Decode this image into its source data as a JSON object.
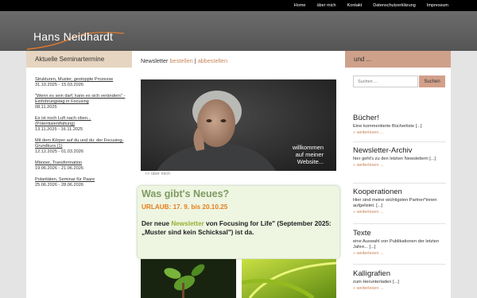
{
  "topnav": [
    "Home",
    "über mich",
    "Kontakt",
    "Datenschutzerklärung",
    "Impressum"
  ],
  "logo": {
    "text": "Hans Neidhardt"
  },
  "left": {
    "title": "Aktuelle Seminartermine",
    "seminars": [
      {
        "title": "Strukturen, Muster, gestoppte Prozesse",
        "date": "31.10.2025 - 15.03.2026"
      },
      {
        "title": "\"Wenn es sein darf, kann es sich verändern\" - Einführungstag in Focusing",
        "date": "08.11.2025"
      },
      {
        "title": "Es ist noch Luft nach oben... (Potentialentfaltung)",
        "date": "13.11.2025 - 16.11.2025"
      },
      {
        "title": "Mit dem Körper auf du und du: der Focusing-Grundkurs (1)",
        "date": "12.12.2025 - 01.03.2026"
      },
      {
        "title": "Männer, Transformation",
        "date": "19.06.2026 - 21.06.2026"
      },
      {
        "title": "Polaritäten, Seminar für Paare",
        "date": "25.06.2026 - 28.06.2026"
      }
    ]
  },
  "center": {
    "newsletter_label": "Newsletter",
    "newsletter_subscribe": "bestellen",
    "newsletter_sep": "|",
    "newsletter_unsubscribe": "abbestellen",
    "hero_caption": [
      "willkommen",
      "auf meiner",
      "Website..."
    ],
    "about_link": ">> über mich",
    "news": {
      "heading": "Was gibt's Neues?",
      "urlaub": "URLAUB: 17. 9. bis 20.10.25",
      "body_pre": "Der neue ",
      "body_link": "Newsletter",
      "body_post": " von Focusing for Life\" (September 2025: „Muster sind kein Schicksal\") ist da."
    }
  },
  "right": {
    "title": "und ...",
    "search": {
      "placeholder": "Suchen ...",
      "button": "Suchen"
    },
    "widgets": [
      {
        "title": "Bücher!",
        "text": "Eine kommentierte Bücherliste [...]",
        "more": "» weiterlesen ..."
      },
      {
        "title": "Newsletter-Archiv",
        "text": "hier geht's zu den letzten Newslettern [...]",
        "more": "» weiterlesen ..."
      },
      {
        "title": "Kooperationen",
        "text": "Hier sind meine wichtigsten Partner*innen aufgelistet. [...]",
        "more": "» weiterlesen ..."
      },
      {
        "title": "Texte",
        "text": "eine Auswahl von Publikationen der letzten Jahre... [...]",
        "more": "» weiterlesen ..."
      },
      {
        "title": "Kalligrafien",
        "text": "zum Herunterladen [...]",
        "more": "» weiterlesen ..."
      }
    ]
  },
  "colors": {
    "accent": "#c9865a",
    "left_header": "#e6d5c0",
    "right_header": "#cea18a",
    "news_green": "#7e9a64",
    "urlaub": "#e57f1a"
  }
}
